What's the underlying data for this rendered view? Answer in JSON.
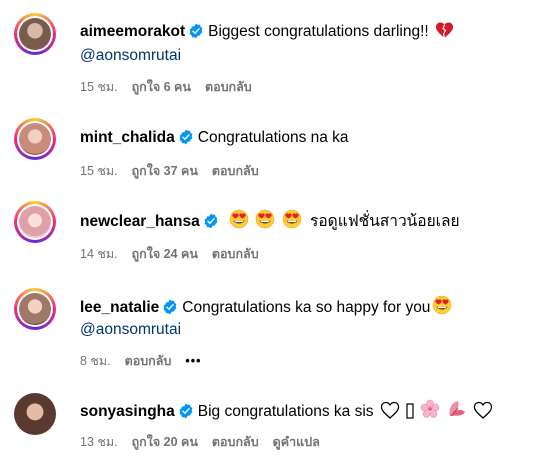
{
  "comments": [
    {
      "username": "aimeemorakot",
      "text": "Biggest congratulations darling!!",
      "mention": "@aonsomrutai",
      "time": "15 ชม.",
      "likes": "ถูกใจ 6 คน",
      "reply": "ตอบกลับ",
      "trailing_icons": [
        "broken-heart-icon"
      ],
      "avatar_color": "#7a5a4a"
    },
    {
      "username": "mint_chalida",
      "text": "Congratulations na ka",
      "time": "15 ชม.",
      "likes": "ถูกใจ 37 คน",
      "reply": "ตอบกลับ",
      "avatar_color": "#c98b7a"
    },
    {
      "username": "newclear_hansa",
      "text": "รอดูแฟชั่นสาวน้อยเลย",
      "time": "14 ชม.",
      "likes": "ถูกใจ 24 คน",
      "reply": "ตอบกลับ",
      "leading_icons": [
        "heart-eyes-emoji-icon",
        "heart-eyes-emoji-icon",
        "heart-eyes-emoji-icon"
      ],
      "avatar_color": "#e0a0a8"
    },
    {
      "username": "lee_natalie",
      "text": "Congratulations ka so happy for you",
      "mention": "@aonsomrutai",
      "time": "8 ชม.",
      "reply": "ตอบกลับ",
      "more": "•••",
      "trailing_icons": [
        "heart-eyes-emoji-icon"
      ],
      "avatar_color": "#a07868"
    },
    {
      "username": "sonyasingha",
      "text": "Big congratulations ka sis",
      "time": "13 ชม.",
      "likes": "ถูกใจ 20 คน",
      "reply": "ตอบกลับ",
      "translate": "ดูคำแปล",
      "trailing_icons": [
        "white-heart-icon",
        "blank-glyph-icon",
        "cherry-blossom-icon",
        "hibiscus-icon",
        "white-heart-icon"
      ],
      "avatar_color": "#5a3a30"
    }
  ],
  "colors": {
    "verified": "#0095f6",
    "mention": "#00376b",
    "meta": "#737373"
  }
}
